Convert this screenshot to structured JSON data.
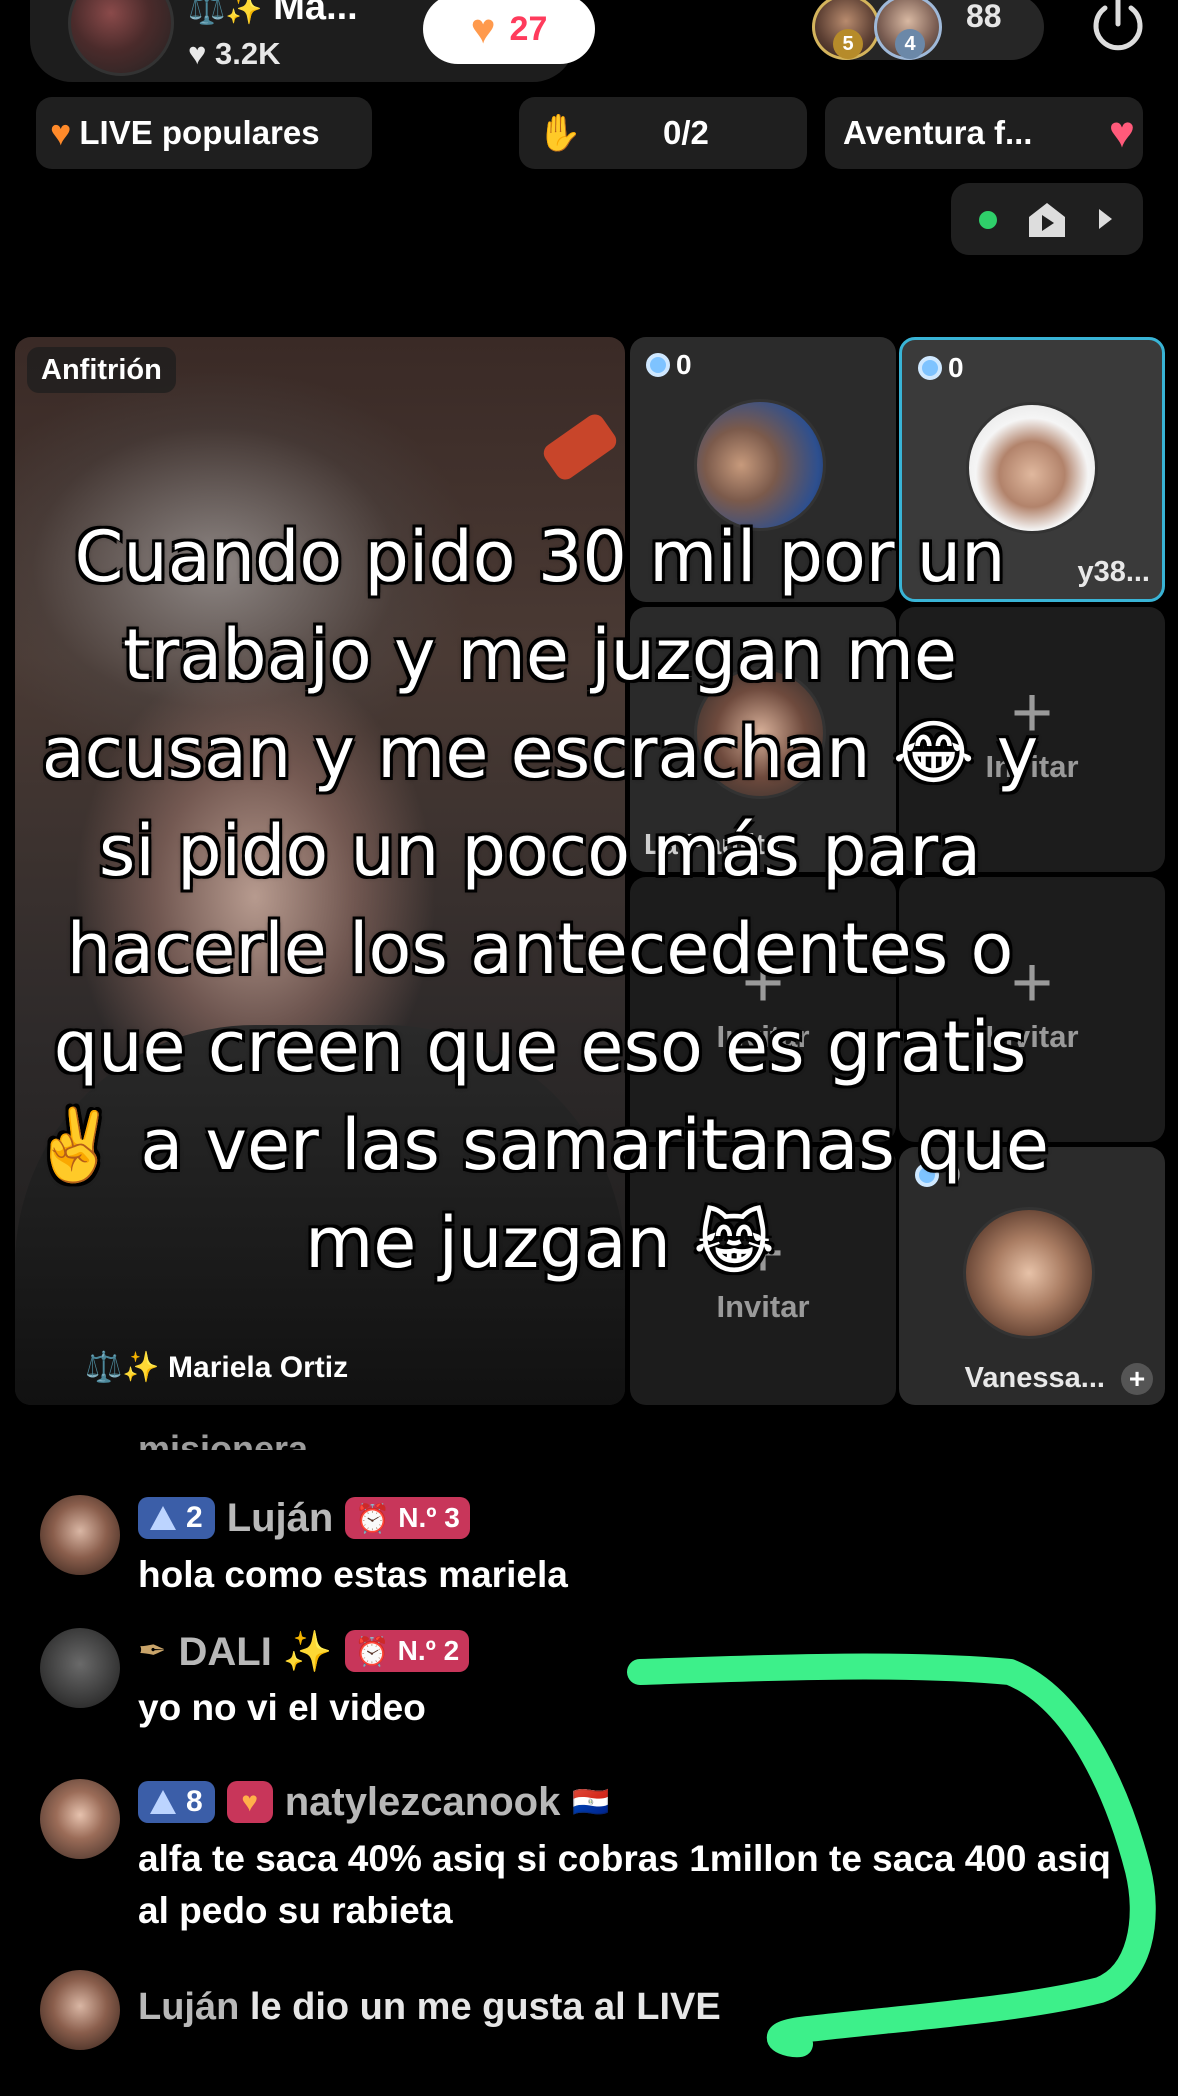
{
  "header": {
    "host_name": "Ma...",
    "host_symbols": "⚖️✨",
    "host_likes": "3.2K",
    "follow_count": "27",
    "viewer_ranks": [
      "5",
      "4"
    ],
    "viewer_count": "88"
  },
  "row2": {
    "popular_label": "LIVE populares",
    "goal_value": "0/2",
    "adventure_label": "Aventura f..."
  },
  "grid": {
    "host_tag": "Anfitrión",
    "host_caption": "⚖️✨ Mariela Ortiz",
    "guests": [
      {
        "score": "0",
        "name": ""
      },
      {
        "score": "0",
        "name": "y38..."
      },
      {
        "name": "La Paulita"
      },
      {
        "score": "0",
        "name": "Vanessa..."
      }
    ],
    "invite_label": "Invitar",
    "invite_plus": "+"
  },
  "overlay_text": "Cuando pido 30 mil por un trabajo y me juzgan me acusan y me escrachan 😂 y si pido un poco más para hacerle los antecedentes o que creen que eso es gratis ✌️ a ver las samaritanas que me juzgan 😹",
  "comments": {
    "cut_text": "misionera",
    "items": [
      {
        "level": "2",
        "user": "Luján",
        "rank": "N.º 3",
        "text": "hola como estas mariela"
      },
      {
        "user": "DALI ✨",
        "rank": "N.º 2",
        "text": "yo no vi el video"
      },
      {
        "level": "8",
        "user": "natylezcanook",
        "flag": "🇵🇾",
        "text": "alfa te saca 40% asiq si cobras 1millon te saca 400 asiq al pedo su rabieta"
      }
    ],
    "like_user": "Luján",
    "like_text": "le dio un me gusta al LIVE"
  },
  "colors": {
    "annotation_stroke": "#3df08a",
    "level_badge": "#3b5ea8",
    "rank_badge": "#c8365a",
    "guest_highlight": "#39b4d6"
  }
}
